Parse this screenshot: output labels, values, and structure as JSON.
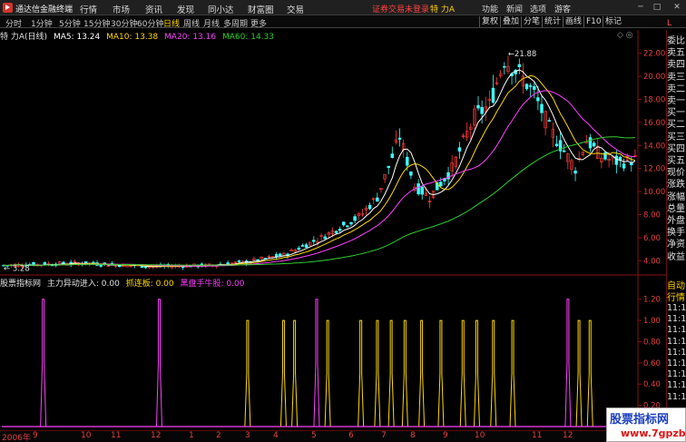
{
  "app": {
    "title": "通达信金融终端"
  },
  "menu": [
    "行情",
    "市场",
    "资讯",
    "发现",
    "同小达",
    "财富圈",
    "交易"
  ],
  "notice": "证券交易未登录",
  "stock_tag": "特 力A",
  "right_menu": [
    "功能",
    "新闻",
    "选项",
    "游客"
  ],
  "window_buttons": [
    "─",
    "□",
    "✕"
  ],
  "periods": [
    "分时",
    "1分钟",
    "5分钟",
    "15分钟",
    "30分钟",
    "60分钟",
    "日线",
    "周线",
    "月线",
    "多周期",
    "更多"
  ],
  "active_period": "日线",
  "tool_buttons": [
    "复权",
    "叠加",
    "分笔",
    "统计",
    "画线",
    "F10",
    "标记"
  ],
  "main_chart": {
    "name": "特 力A",
    "period": "(日线)",
    "ma": [
      {
        "label": "MA5: 13.24",
        "color": "#ffffff"
      },
      {
        "label": "MA10: 13.38",
        "color": "#ffd800"
      },
      {
        "label": "MA20: 13.16",
        "color": "#ff40ff"
      },
      {
        "label": "MA60: 14.33",
        "color": "#30d030"
      }
    ],
    "y_ticks": [
      "22.00",
      "20.00",
      "18.00",
      "16.00",
      "14.00",
      "12.00",
      "10.00",
      "8.00",
      "6.00",
      "4.00"
    ],
    "high_label": "21.88",
    "low_label": "3.28",
    "colors": {
      "up": "#ff3c3c",
      "down": "#3cffff",
      "ma5": "#ffffff",
      "ma10": "#ffd800",
      "ma20": "#ff40ff",
      "ma60": "#30d030"
    }
  },
  "sub_chart": {
    "name": "股票指标网",
    "items": [
      {
        "label": "主力异动进入: 0.00",
        "color": "#e0e0e0"
      },
      {
        "label": "抓连板: 0.00",
        "color": "#ffd800"
      },
      {
        "label": "黑盘手牛股: 0.00",
        "color": "#ff40ff"
      }
    ],
    "y_ticks": [
      "1.20",
      "1.00",
      "0.80",
      "0.60",
      "0.40",
      "0.20",
      "0.00"
    ]
  },
  "x_axis": [
    "2006年",
    "9",
    "10",
    "11",
    "12",
    "1",
    "2",
    "3",
    "4",
    "5",
    "6",
    "7",
    "8",
    "9",
    "10",
    "11",
    "12"
  ],
  "right_panel": {
    "corner": "L",
    "labels": [
      "委比",
      "卖五",
      "卖四",
      "卖三",
      "卖二",
      "卖一",
      "买一",
      "买二",
      "买三",
      "买四",
      "买五",
      "现价",
      "涨跌",
      "涨幅",
      "总量",
      "外盘",
      "换手",
      "净资",
      "收益"
    ],
    "bottom_labels": [
      "自动",
      "行情"
    ],
    "times": [
      "11:1",
      "11:1",
      "11:1",
      "11:1",
      "11:1",
      "11:1",
      "11:1",
      "11:1",
      "11:1"
    ]
  },
  "watermark": {
    "line1": "股票指标网",
    "line2": "www.7gpzb.com"
  }
}
